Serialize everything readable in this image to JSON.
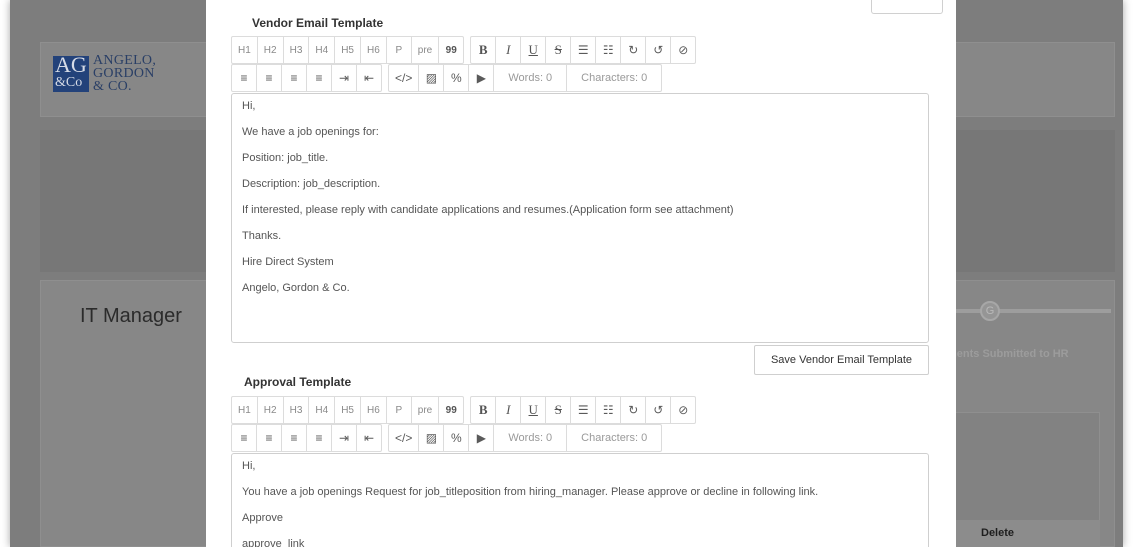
{
  "background": {
    "logo": {
      "mark_line1": "AG",
      "mark_line2": "&Co",
      "text_line1": "ANGELO,",
      "text_line2": "GORDON",
      "text_line3": "& CO."
    },
    "page_title": "IT Manager",
    "progress_step_label": "G",
    "status_label": "ments Submitted to HR",
    "table_header_delete": "Delete"
  },
  "modal": {
    "vendor_section": {
      "title": "Vendor Email Template",
      "toolbar_row1": [
        "H1",
        "H2",
        "H3",
        "H4",
        "H5",
        "H6",
        "P",
        "pre",
        "99",
        "B",
        "I",
        "U",
        "S",
        "☰",
        "☷",
        "↻",
        "↺",
        "⊘"
      ],
      "words": "Words: 0",
      "characters": "Characters: 0",
      "body_lines": [
        "Hi,",
        "We have a job openings for:",
        "Position: job_title.",
        "Description: job_description.",
        "If interested, please reply with candidate applications and resumes.(Application form see attachment)",
        "Thanks.",
        "Hire Direct System",
        "Angelo, Gordon & Co."
      ],
      "save_button": "Save Vendor Email Template"
    },
    "approval_section": {
      "title": "Approval Template",
      "words": "Words: 0",
      "characters": "Characters: 0",
      "body_lines": [
        "Hi,",
        "You have a job openings Request for job_titleposition from hiring_manager. Please approve or decline in following link.",
        "Approve",
        "approve_link"
      ]
    }
  }
}
